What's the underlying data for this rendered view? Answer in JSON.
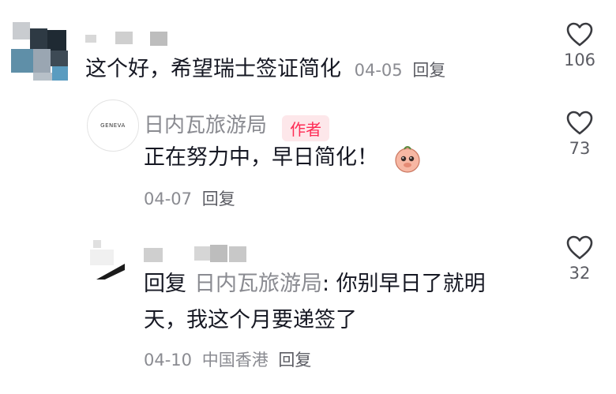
{
  "comments": [
    {
      "content": "这个好，希望瑞士签证简化",
      "date": "04-05",
      "reply_label": "回复",
      "likes": "106"
    },
    {
      "author": "日内瓦旅游局",
      "badge": "作者",
      "avatar_text": "GENEVA",
      "content": "正在努力中，早日简化！",
      "date": "04-07",
      "reply_label": "回复",
      "likes": "73"
    },
    {
      "reply_prefix": "回复",
      "reply_target": "日内瓦旅游局",
      "content_line1": ": 你别早日了就明",
      "content_line2": "天，我这个月要递签了",
      "date": "04-10",
      "location": "中国香港",
      "reply_label": "回复",
      "likes": "32"
    }
  ]
}
